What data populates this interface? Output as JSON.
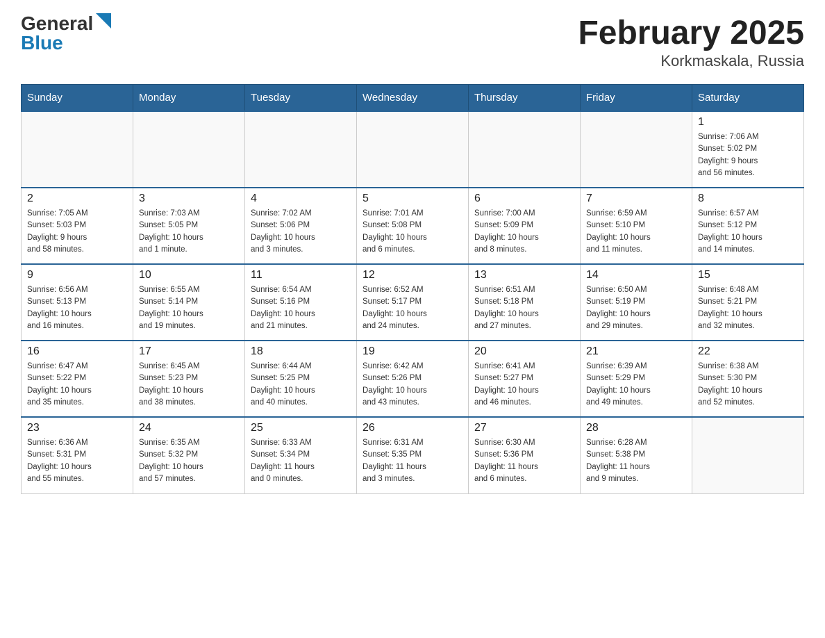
{
  "header": {
    "logo_general": "General",
    "logo_blue": "Blue",
    "title": "February 2025",
    "subtitle": "Korkmaskala, Russia"
  },
  "days_of_week": [
    "Sunday",
    "Monday",
    "Tuesday",
    "Wednesday",
    "Thursday",
    "Friday",
    "Saturday"
  ],
  "weeks": [
    [
      {
        "day": "",
        "info": ""
      },
      {
        "day": "",
        "info": ""
      },
      {
        "day": "",
        "info": ""
      },
      {
        "day": "",
        "info": ""
      },
      {
        "day": "",
        "info": ""
      },
      {
        "day": "",
        "info": ""
      },
      {
        "day": "1",
        "info": "Sunrise: 7:06 AM\nSunset: 5:02 PM\nDaylight: 9 hours\nand 56 minutes."
      }
    ],
    [
      {
        "day": "2",
        "info": "Sunrise: 7:05 AM\nSunset: 5:03 PM\nDaylight: 9 hours\nand 58 minutes."
      },
      {
        "day": "3",
        "info": "Sunrise: 7:03 AM\nSunset: 5:05 PM\nDaylight: 10 hours\nand 1 minute."
      },
      {
        "day": "4",
        "info": "Sunrise: 7:02 AM\nSunset: 5:06 PM\nDaylight: 10 hours\nand 3 minutes."
      },
      {
        "day": "5",
        "info": "Sunrise: 7:01 AM\nSunset: 5:08 PM\nDaylight: 10 hours\nand 6 minutes."
      },
      {
        "day": "6",
        "info": "Sunrise: 7:00 AM\nSunset: 5:09 PM\nDaylight: 10 hours\nand 8 minutes."
      },
      {
        "day": "7",
        "info": "Sunrise: 6:59 AM\nSunset: 5:10 PM\nDaylight: 10 hours\nand 11 minutes."
      },
      {
        "day": "8",
        "info": "Sunrise: 6:57 AM\nSunset: 5:12 PM\nDaylight: 10 hours\nand 14 minutes."
      }
    ],
    [
      {
        "day": "9",
        "info": "Sunrise: 6:56 AM\nSunset: 5:13 PM\nDaylight: 10 hours\nand 16 minutes."
      },
      {
        "day": "10",
        "info": "Sunrise: 6:55 AM\nSunset: 5:14 PM\nDaylight: 10 hours\nand 19 minutes."
      },
      {
        "day": "11",
        "info": "Sunrise: 6:54 AM\nSunset: 5:16 PM\nDaylight: 10 hours\nand 21 minutes."
      },
      {
        "day": "12",
        "info": "Sunrise: 6:52 AM\nSunset: 5:17 PM\nDaylight: 10 hours\nand 24 minutes."
      },
      {
        "day": "13",
        "info": "Sunrise: 6:51 AM\nSunset: 5:18 PM\nDaylight: 10 hours\nand 27 minutes."
      },
      {
        "day": "14",
        "info": "Sunrise: 6:50 AM\nSunset: 5:19 PM\nDaylight: 10 hours\nand 29 minutes."
      },
      {
        "day": "15",
        "info": "Sunrise: 6:48 AM\nSunset: 5:21 PM\nDaylight: 10 hours\nand 32 minutes."
      }
    ],
    [
      {
        "day": "16",
        "info": "Sunrise: 6:47 AM\nSunset: 5:22 PM\nDaylight: 10 hours\nand 35 minutes."
      },
      {
        "day": "17",
        "info": "Sunrise: 6:45 AM\nSunset: 5:23 PM\nDaylight: 10 hours\nand 38 minutes."
      },
      {
        "day": "18",
        "info": "Sunrise: 6:44 AM\nSunset: 5:25 PM\nDaylight: 10 hours\nand 40 minutes."
      },
      {
        "day": "19",
        "info": "Sunrise: 6:42 AM\nSunset: 5:26 PM\nDaylight: 10 hours\nand 43 minutes."
      },
      {
        "day": "20",
        "info": "Sunrise: 6:41 AM\nSunset: 5:27 PM\nDaylight: 10 hours\nand 46 minutes."
      },
      {
        "day": "21",
        "info": "Sunrise: 6:39 AM\nSunset: 5:29 PM\nDaylight: 10 hours\nand 49 minutes."
      },
      {
        "day": "22",
        "info": "Sunrise: 6:38 AM\nSunset: 5:30 PM\nDaylight: 10 hours\nand 52 minutes."
      }
    ],
    [
      {
        "day": "23",
        "info": "Sunrise: 6:36 AM\nSunset: 5:31 PM\nDaylight: 10 hours\nand 55 minutes."
      },
      {
        "day": "24",
        "info": "Sunrise: 6:35 AM\nSunset: 5:32 PM\nDaylight: 10 hours\nand 57 minutes."
      },
      {
        "day": "25",
        "info": "Sunrise: 6:33 AM\nSunset: 5:34 PM\nDaylight: 11 hours\nand 0 minutes."
      },
      {
        "day": "26",
        "info": "Sunrise: 6:31 AM\nSunset: 5:35 PM\nDaylight: 11 hours\nand 3 minutes."
      },
      {
        "day": "27",
        "info": "Sunrise: 6:30 AM\nSunset: 5:36 PM\nDaylight: 11 hours\nand 6 minutes."
      },
      {
        "day": "28",
        "info": "Sunrise: 6:28 AM\nSunset: 5:38 PM\nDaylight: 11 hours\nand 9 minutes."
      },
      {
        "day": "",
        "info": ""
      }
    ]
  ]
}
